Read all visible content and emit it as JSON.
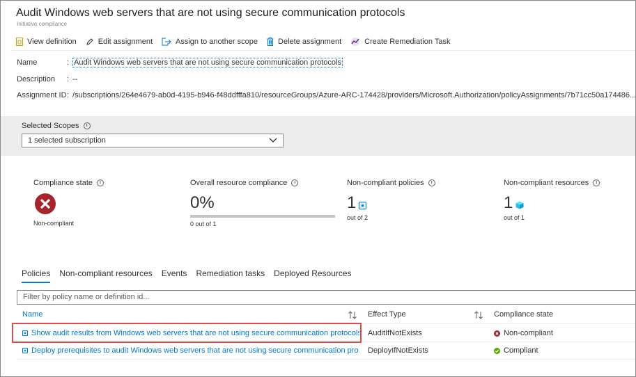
{
  "header": {
    "title": "Audit Windows web servers that are not using secure communication protocols",
    "subtitle": "Initiative compliance"
  },
  "toolbar": {
    "view_definition": "View definition",
    "edit_assignment": "Edit assignment",
    "assign_scope": "Assign to another scope",
    "delete_assignment": "Delete assignment",
    "create_remediation": "Create Remediation Task"
  },
  "properties": {
    "name_label": "Name",
    "name_value": "Audit Windows web servers that are not using secure communication protocols",
    "description_label": "Description",
    "description_value": "--",
    "assignment_id_label": "Assignment ID",
    "assignment_id_value": "/subscriptions/264e4679-ab0d-4195-b946-f48ddfffa810/resourceGroups/Azure-ARC-174428/providers/Microsoft.Authorization/policyAssignments/7b71cc50a174486..."
  },
  "scopes": {
    "label": "Selected Scopes",
    "selected": "1 selected subscription"
  },
  "summary": {
    "compliance_state": {
      "title": "Compliance state",
      "value": "Non-compliant"
    },
    "overall": {
      "title": "Overall resource compliance",
      "value": "0%",
      "note": "0 out of 1",
      "fraction": 0
    },
    "policies": {
      "title": "Non-compliant policies",
      "value": "1",
      "note": "out of 2"
    },
    "resources": {
      "title": "Non-compliant resources",
      "value": "1",
      "note": "out of 1"
    }
  },
  "tabs": [
    "Policies",
    "Non-compliant resources",
    "Events",
    "Remediation tasks",
    "Deployed Resources"
  ],
  "filter": {
    "placeholder": "Filter by policy name or definition id..."
  },
  "table": {
    "headers": {
      "name": "Name",
      "effect": "Effect Type",
      "state": "Compliance state"
    },
    "rows": [
      {
        "name": "Show audit results from Windows web servers that are not using secure communication protocols",
        "effect": "AuditIfNotExists",
        "state": "Non-compliant"
      },
      {
        "name": "Deploy prerequisites to audit Windows web servers that are not using secure communication pro...",
        "effect": "DeployIfNotExists",
        "state": "Compliant"
      }
    ]
  },
  "colors": {
    "accent": "#0078d4",
    "error": "#a4262c",
    "success": "#57a300",
    "highlight": "#e04a4a"
  }
}
